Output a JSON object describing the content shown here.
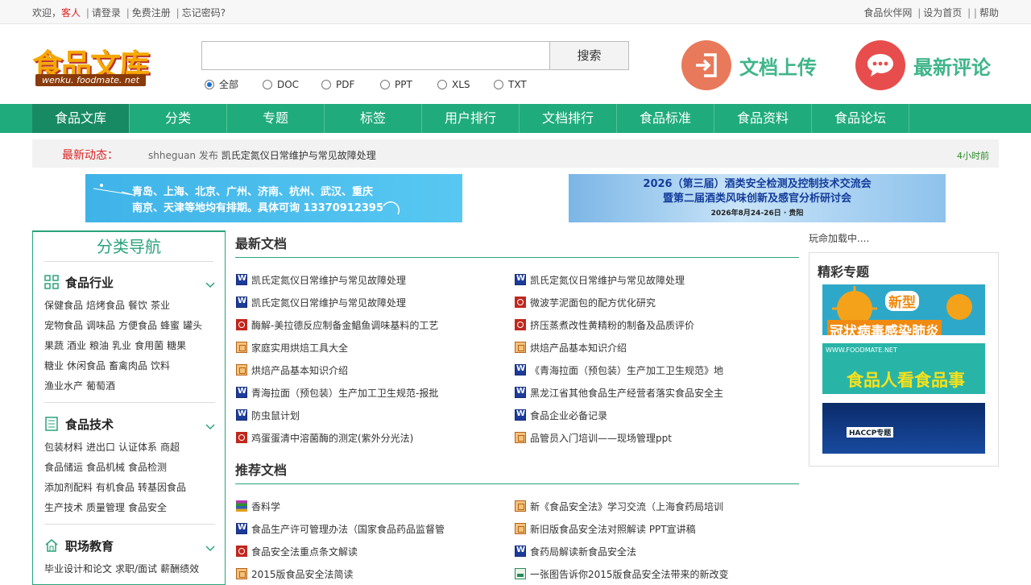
{
  "topbar": {
    "welcome": "欢迎，",
    "guest": "客人",
    "login": "请登录",
    "register": "免费注册",
    "forgot": "忘记密码?",
    "partner": "食品伙伴网",
    "homepage": "设为首页",
    "help": "帮助",
    "sep": "|",
    "sep2": "| |"
  },
  "logo": {
    "text": "食品文库",
    "url": "wenku. foodmate. net"
  },
  "search": {
    "value": "",
    "button": "搜索",
    "types": [
      {
        "label": "全部",
        "checked": true
      },
      {
        "label": "DOC",
        "checked": false
      },
      {
        "label": "PDF",
        "checked": false
      },
      {
        "label": "PPT",
        "checked": false
      },
      {
        "label": "XLS",
        "checked": false
      },
      {
        "label": "TXT",
        "checked": false
      }
    ]
  },
  "header_actions": {
    "upload": "文档上传",
    "comments": "最新评论",
    "upload_color": "#e8795a",
    "comments_color": "#e84d4d"
  },
  "nav": [
    "食品文库",
    "分类",
    "专题",
    "标签",
    "用户排行",
    "文档排行",
    "食品标准",
    "食品资料",
    "食品论坛"
  ],
  "news": {
    "label": "最新动态：",
    "user": "shheguan",
    "action": "发布",
    "title": "凯氏定氮仪日常维护与常见故障处理",
    "time": "4小时前"
  },
  "banners": {
    "left_line1": "青岛、上海、北京、广州、济南、杭州、武汉、重庆",
    "left_line2": "南京、天津等地均有排期。具体可询 13370912395",
    "right_line1": "2026（第三届）酒类安全检测及控制技术交流会",
    "right_line2": "暨第二届酒类风味创新及感官分析研讨会",
    "right_date": "2026年8月24-26日 · 贵阳"
  },
  "sidebar": {
    "title": "分类导航",
    "cats": [
      {
        "title": "食品行业",
        "lines": [
          [
            "保健食品",
            "焙烤食品",
            "餐饮",
            "茶业"
          ],
          [
            "宠物食品",
            "调味品",
            "方便食品",
            "蜂蜜",
            "罐头"
          ],
          [
            "果蔬",
            "酒业",
            "粮油",
            "乳业",
            "食用菌",
            "糖果"
          ],
          [
            "糖业",
            "休闲食品",
            "畜禽肉品",
            "饮料"
          ],
          [
            "渔业水产",
            "葡萄酒"
          ]
        ]
      },
      {
        "title": "食品技术",
        "lines": [
          [
            "包装材料",
            "进出口",
            "认证体系",
            "商超"
          ],
          [
            "食品储运",
            "食品机械",
            "食品检测"
          ],
          [
            "添加剂配料",
            "有机食品",
            "转基因食品"
          ],
          [
            "生产技术",
            "质量管理",
            "食品安全"
          ]
        ]
      },
      {
        "title": "职场教育",
        "lines": [
          [
            "毕业设计和论文",
            "求职/面试",
            "薪酬绩效"
          ]
        ]
      }
    ]
  },
  "latest": {
    "title": "最新文档",
    "left": [
      {
        "type": "w",
        "name": "凯氏定氮仪日常维护与常见故障处理"
      },
      {
        "type": "w",
        "name": "凯氏定氮仪日常维护与常见故障处理"
      },
      {
        "type": "p",
        "name": "酶解-美拉德反应制备金鲳鱼调味基料的工艺"
      },
      {
        "type": "t",
        "name": "家庭实用烘焙工具大全"
      },
      {
        "type": "t",
        "name": "烘焙产品基本知识介绍"
      },
      {
        "type": "w",
        "name": "青海拉面（预包装）生产加工卫生规范-报批"
      },
      {
        "type": "w",
        "name": "防虫鼠计划"
      },
      {
        "type": "p",
        "name": "鸡蛋蛋清中溶菌酶的测定(紫外分光法)"
      }
    ],
    "right": [
      {
        "type": "w",
        "name": "凯氏定氮仪日常维护与常见故障处理"
      },
      {
        "type": "p",
        "name": "微波芋泥面包的配方优化研究"
      },
      {
        "type": "p",
        "name": "挤压蒸煮改性黄精粉的制备及品质评价"
      },
      {
        "type": "t",
        "name": "烘焙产品基本知识介绍"
      },
      {
        "type": "w",
        "name": "《青海拉面（预包装）生产加工卫生规范》地"
      },
      {
        "type": "w",
        "name": "黑龙江省其他食品生产经营者落实食品安全主"
      },
      {
        "type": "w",
        "name": "食品企业必备记录"
      },
      {
        "type": "t",
        "name": "品管员入门培训——现场管理ppt"
      }
    ]
  },
  "recommended": {
    "title": "推荐文档",
    "left": [
      {
        "type": "z",
        "name": "香料学"
      },
      {
        "type": "w",
        "name": "食品生产许可管理办法（国家食品药品监督管"
      },
      {
        "type": "p",
        "name": "食品安全法重点条文解读"
      },
      {
        "type": "t",
        "name": "2015版食品安全法简读"
      }
    ],
    "right": [
      {
        "type": "t",
        "name": "新《食品安全法》学习交流（上海食药局培训"
      },
      {
        "type": "t",
        "name": "新旧版食品安全法对照解读 PPT宣讲稿"
      },
      {
        "type": "w",
        "name": "食药局解读新食品安全法"
      },
      {
        "type": "i",
        "name": "一张图告诉你2015版食品安全法带来的新改变"
      }
    ]
  },
  "right_panel": {
    "loading": "玩命加载中....",
    "title": "精彩专题",
    "topic1": "新型",
    "topic1_sub": "冠状病毒感染肺炎",
    "topic2_url": "WWW.FOODMATE.NET",
    "topic2": "食品人看食品事",
    "topic3": "HACCP专题"
  }
}
